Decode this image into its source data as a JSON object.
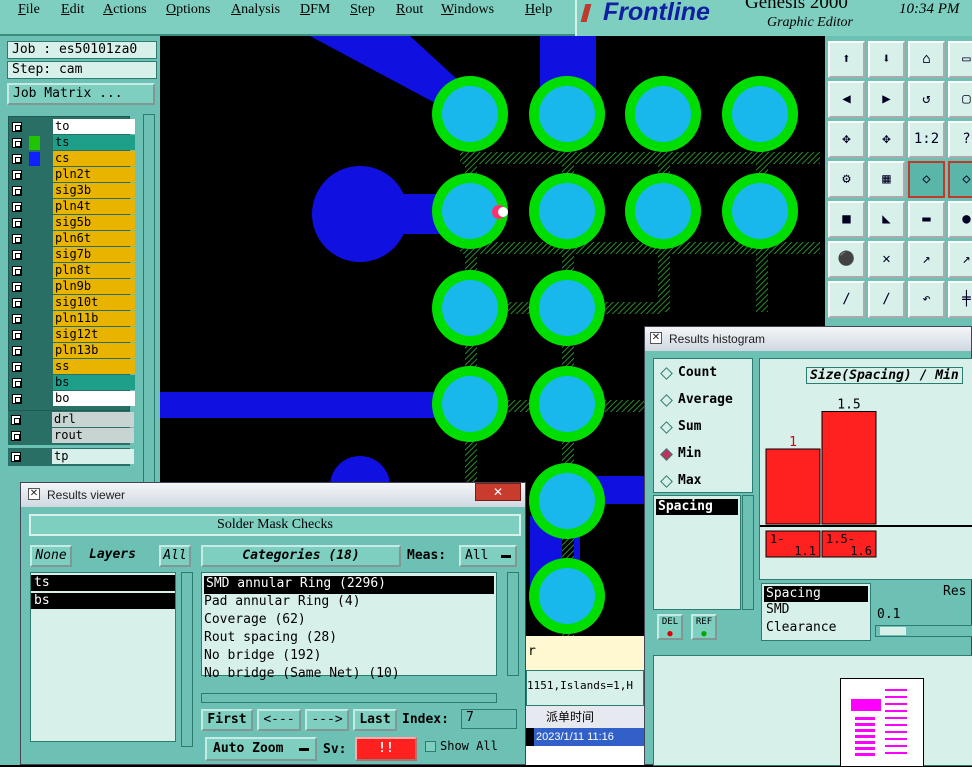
{
  "menu": {
    "items": [
      "File",
      "Edit",
      "Actions",
      "Options",
      "Analysis",
      "DFM",
      "Step",
      "Rout",
      "Windows",
      "Help"
    ]
  },
  "brand": {
    "name": "Frontline",
    "product": "Genesis 2000",
    "subtitle": "Graphic Editor",
    "time": "10:34 PM"
  },
  "job": {
    "job_label": "Job : es50101za0",
    "step_label": "Step: cam",
    "matrix_button": "Job Matrix ..."
  },
  "layers": [
    {
      "name": "to",
      "color": "#ffffff",
      "dot": ""
    },
    {
      "name": "ts",
      "color": "#1e9f8a",
      "dot": "#21c400"
    },
    {
      "name": "cs",
      "color": "#e8b400",
      "dot": "#1020ff"
    },
    {
      "name": "pln2t",
      "color": "#e8b400",
      "dot": ""
    },
    {
      "name": "sig3b",
      "color": "#e8b400",
      "dot": ""
    },
    {
      "name": "pln4t",
      "color": "#e8b400",
      "dot": ""
    },
    {
      "name": "sig5b",
      "color": "#e8b400",
      "dot": ""
    },
    {
      "name": "pln6t",
      "color": "#e8b400",
      "dot": ""
    },
    {
      "name": "sig7b",
      "color": "#e8b400",
      "dot": ""
    },
    {
      "name": "pln8t",
      "color": "#e8b400",
      "dot": ""
    },
    {
      "name": "pln9b",
      "color": "#e8b400",
      "dot": ""
    },
    {
      "name": "sig10t",
      "color": "#e8b400",
      "dot": ""
    },
    {
      "name": "pln11b",
      "color": "#e8b400",
      "dot": ""
    },
    {
      "name": "sig12t",
      "color": "#e8b400",
      "dot": ""
    },
    {
      "name": "pln13b",
      "color": "#e8b400",
      "dot": ""
    },
    {
      "name": "ss",
      "color": "#e8b400",
      "dot": ""
    },
    {
      "name": "bs",
      "color": "#1e9f8a",
      "dot": ""
    },
    {
      "name": "bo",
      "color": "#ffffff",
      "dot": ""
    }
  ],
  "drill_layers": [
    {
      "name": "drl"
    },
    {
      "name": "rout"
    }
  ],
  "extra_layers": [
    {
      "name": "tp"
    }
  ],
  "tools": {
    "labels": [
      "1:2",
      "?"
    ]
  },
  "results_viewer": {
    "title": "Results viewer",
    "header": "Solder Mask Checks",
    "none_btn": "None",
    "layers_label": "Layers",
    "all_btn": "All",
    "layers": [
      "ts",
      "bs"
    ],
    "categories_label": "Categories (18)",
    "meas_label": "Meas:",
    "meas_value": "All",
    "categories": [
      "SMD annular Ring (2296)",
      "Pad annular Ring (4)",
      "Coverage (62)",
      "Rout spacing (28)",
      "No bridge (192)",
      "No bridge (Same Net) (10)"
    ],
    "nav": {
      "first": "First",
      "prev": "<---",
      "next": "--->",
      "last": "Last",
      "index_label": "Index:",
      "index_value": "7"
    },
    "auto_zoom": "Auto Zoom",
    "sv_label": "Sv:",
    "sv_value": "!!",
    "show_all": "Show All"
  },
  "histogram": {
    "title": "Results histogram",
    "options": [
      "Count",
      "Average",
      "Sum",
      "Min",
      "Max"
    ],
    "selected": "Min",
    "list": [
      "Spacing"
    ],
    "del": "DEL",
    "ref": "REF",
    "chart_title": "Size(Spacing) / Min",
    "right_list": [
      "Spacing",
      "SMD",
      "Clearance"
    ],
    "res_label": "Res",
    "res_value": "0.1"
  },
  "chart_data": {
    "type": "bar",
    "title": "Size(Spacing) / Min",
    "categories": [
      "1-1.1",
      "1.5-1.6"
    ],
    "values": [
      1,
      1.5
    ],
    "ylim": [
      0,
      1.6
    ],
    "color": "#ff2020"
  },
  "taskbar": {
    "col_header": "派单时间",
    "date": "2023/1/11 11:16",
    "status_text": "1151,Islands=1,H",
    "r_char": "r"
  }
}
